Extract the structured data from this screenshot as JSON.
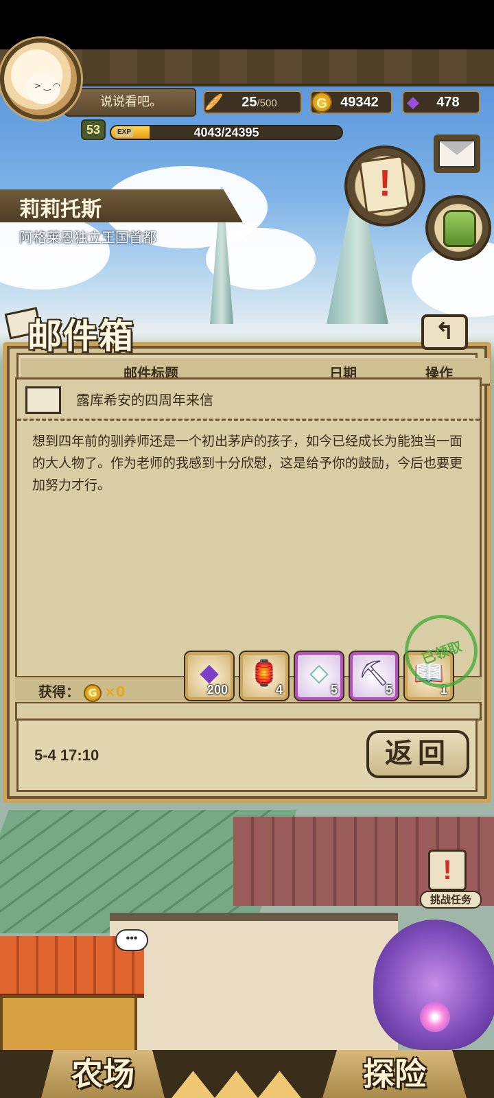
{
  "player": {
    "motto": "说说看吧。",
    "level": "53",
    "exp_tag": "EXP",
    "exp_text": "4043/24395",
    "exp_progress": 0.166,
    "name": "莉莉托斯",
    "location": "阿格莱恩独立王国首都"
  },
  "resources": {
    "bread": {
      "icon": "bread-icon",
      "value": "25",
      "max": "/500"
    },
    "gold": {
      "icon": "gold-coin-icon",
      "symbol": "G",
      "value": "49342"
    },
    "gem": {
      "icon": "purple-gem-icon",
      "value": "478"
    }
  },
  "mailbox": {
    "title": "邮件箱",
    "back_glyph": "↰",
    "columns": {
      "subject": "邮件标题",
      "date": "日期",
      "action": "操作"
    },
    "message": {
      "subject": "露库希安的四周年来信",
      "body": "想到四年前的驯养师还是一个初出茅庐的孩子，如今已经成长为能独当一面的大人物了。作为老师的我感到十分欣慰，这是给予你的鼓励，今后也要更加努力才行。",
      "obtain_label": "获得：",
      "gold_symbol": "G",
      "gold_amount": "×0",
      "stamp_text": "已领取",
      "rewards": [
        {
          "icon": "purple-gem-icon",
          "glyph": "◆",
          "count": "200"
        },
        {
          "icon": "winged-lantern-icon",
          "glyph": "🏮",
          "count": "4"
        },
        {
          "icon": "crystal-shard-icon",
          "glyph": "◇",
          "count": "5"
        },
        {
          "icon": "pickaxe-icon",
          "glyph": "⛏",
          "count": "5"
        },
        {
          "icon": "book-icon",
          "glyph": "📖",
          "count": "1"
        }
      ],
      "date": "5-4 17:10",
      "return_label": "返回"
    }
  },
  "town": {
    "challenge_label": "挑战任务",
    "challenge_glyph": "!",
    "bubble": "•••"
  },
  "nav": {
    "farm": "农场",
    "explore": "探险"
  },
  "colors": {
    "panel_bg": "#e2d6b0",
    "frame_brown": "#3a2d1a",
    "accent_gold": "#caa35c",
    "stamp_green": "#3caa32"
  }
}
